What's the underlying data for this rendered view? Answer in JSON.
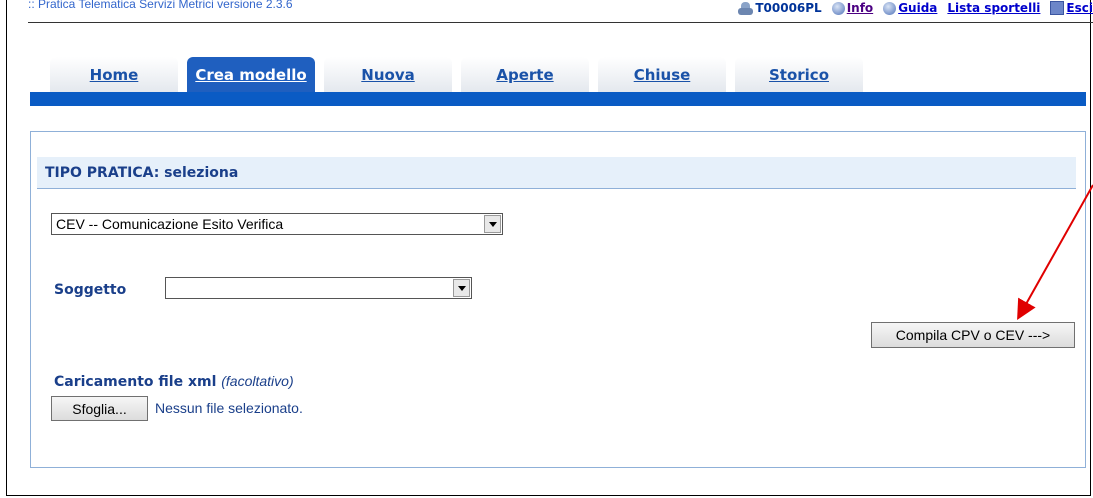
{
  "app": {
    "title": ":: Pratica Telematica Servizi Metrici versione 2.3.6",
    "user_id": "T00006PL",
    "links": {
      "info": "Info",
      "guida": "Guida",
      "lista_sportelli": "Lista sportelli",
      "esci": "Esci"
    }
  },
  "tabs": [
    {
      "label": "Home",
      "active": false
    },
    {
      "label": "Crea modello",
      "active": true
    },
    {
      "label": "Nuova",
      "active": false
    },
    {
      "label": "Aperte",
      "active": false
    },
    {
      "label": "Chiuse",
      "active": false
    },
    {
      "label": "Storico",
      "active": false
    }
  ],
  "form": {
    "header": "TIPO PRATICA: seleziona",
    "tipo_select_value": "CEV -- Comunicazione Esito Verifica",
    "soggetto_label": "Soggetto",
    "soggetto_select_value": "",
    "compila_button": "Compila CPV o CEV --->",
    "upload_label": "Caricamento file xml",
    "upload_optional": "(facoltativo)",
    "browse_button": "Sfoglia...",
    "file_status": "Nessun file selezionato."
  },
  "colors": {
    "accent": "#0a5bc4",
    "annotation_arrow": "#e00000"
  },
  "icons": [
    "user-icon",
    "info-icon",
    "help-icon",
    "exit-icon"
  ]
}
